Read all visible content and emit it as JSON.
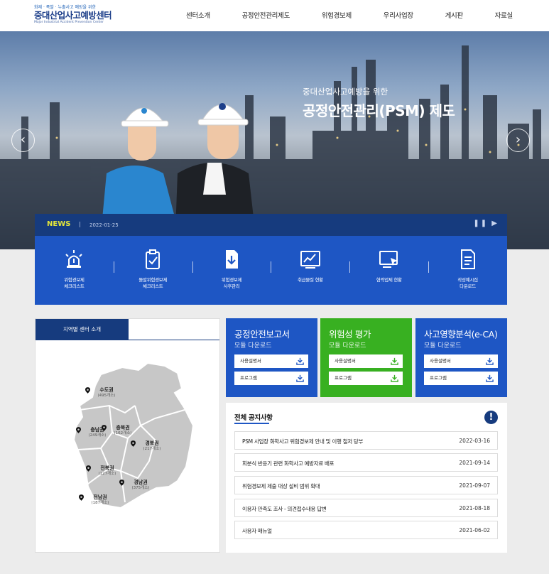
{
  "header": {
    "logo_tagline": "화재 · 폭발 · 누출사고 예방을 위한",
    "logo_name": "중대산업사고예방센터",
    "logo_english": "Major Industrial Accident Prevention Center",
    "nav": [
      "센터소개",
      "공정안전관리제도",
      "위험경보제",
      "우리사업장",
      "게시판",
      "자료실"
    ]
  },
  "hero": {
    "subtitle": "중대산업사고예방을 위한",
    "title": "공정안전관리(PSM) 제도",
    "prev_icon": "chevron-left-icon",
    "next_icon": "chevron-right-icon"
  },
  "news": {
    "label": "NEWS",
    "separator": "|",
    "date": "2022-01-25",
    "controls": "❚❚ ▶"
  },
  "quick_links": [
    {
      "icon": "alarm-light-icon",
      "label": "위험경보제\n체크리스트"
    },
    {
      "icon": "clipboard-check-icon",
      "label": "돌발위험경보제\n체크리스트"
    },
    {
      "icon": "document-download-icon",
      "label": "위험경보제\n사후관리"
    },
    {
      "icon": "line-chart-icon",
      "label": "취급물질 현황"
    },
    {
      "icon": "monitor-cursor-icon",
      "label": "협력업체 현황"
    },
    {
      "icon": "document-list-icon",
      "label": "작성예시집\n다운로드"
    }
  ],
  "region": {
    "tab_label": "지역별 센터 소개",
    "pins": [
      {
        "name": "수도권",
        "count": "(495개소)"
      },
      {
        "name": "충남권",
        "count": "(249개소)"
      },
      {
        "name": "충북권",
        "count": "(162개소)"
      },
      {
        "name": "경북권",
        "count": "(217개소)"
      },
      {
        "name": "전북권",
        "count": "(127개소)"
      },
      {
        "name": "경남권",
        "count": "(375개소)"
      },
      {
        "name": "전남권",
        "count": "(187개소)"
      }
    ]
  },
  "cards": [
    {
      "title": "공정안전보고서",
      "subtitle": "모듈 다운로드",
      "color": "#1e56c4",
      "buttons": [
        "사용설명서",
        "프로그램"
      ]
    },
    {
      "title": "위험성 평가",
      "subtitle": "모듈 다운로드",
      "color": "#38b021",
      "buttons": [
        "사용설명서",
        "프로그램"
      ]
    },
    {
      "title": "사고영향분석(e-CA)",
      "subtitle": "모듈 다운로드",
      "color": "#1e56c4",
      "buttons": [
        "사용설명서",
        "프로그램"
      ]
    }
  ],
  "notices": {
    "title": "전체 공지사항",
    "info_icon": "!",
    "items": [
      {
        "title": "PSM 사업장 화학사고 위험경보제 안내 및 이행 철저 당부",
        "date": "2022-03-16"
      },
      {
        "title": "회분식 반응기 관련 화학사고 예방자료 배포",
        "date": "2021-09-14"
      },
      {
        "title": "위험경보제 제출 대상 설비 범위 확대",
        "date": "2021-09-07"
      },
      {
        "title": "이용자 만족도 조사 - 의견접수내용 답변",
        "date": "2021-08-18"
      },
      {
        "title": "사용자 매뉴얼",
        "date": "2021-06-02"
      }
    ]
  },
  "colors": {
    "navy": "#163b7e",
    "blue": "#1e56c4",
    "green": "#38b021",
    "news_label": "#e4e63b"
  }
}
